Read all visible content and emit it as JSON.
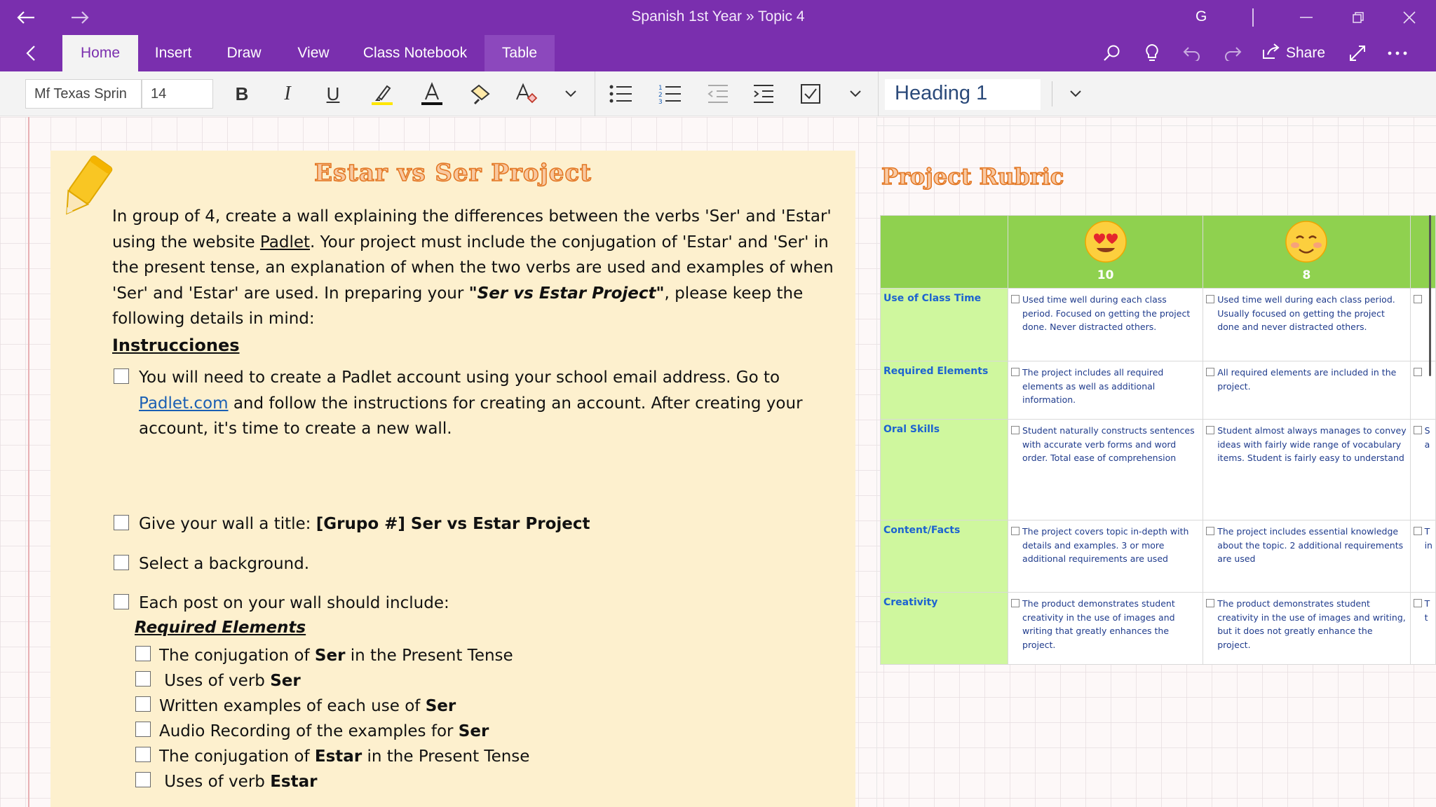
{
  "window": {
    "title": "Spanish 1st Year » Topic 4",
    "user_initial": "G"
  },
  "tabs": {
    "items": [
      {
        "label": "Home",
        "active": true
      },
      {
        "label": "Insert"
      },
      {
        "label": "Draw"
      },
      {
        "label": "View"
      },
      {
        "label": "Class Notebook"
      },
      {
        "label": "Table"
      }
    ],
    "share_label": "Share"
  },
  "toolbar": {
    "font_name": "Mf Texas Sprin",
    "font_size": "14",
    "style": "Heading 1",
    "highlight_color": "#ffe600",
    "font_color": "#111111"
  },
  "project": {
    "title": "Estar vs Ser Project",
    "intro": {
      "p1": "In group of 4, create a wall explaining the differences between the verbs 'Ser' and 'Estar' using the website ",
      "link1": "Padlet",
      "p2": ". Your project must include the conjugation of 'Estar' and 'Ser' in the present tense, an explanation of when the two verbs are used and examples of when 'Ser' and 'Estar' are used. In preparing your ",
      "bold_italic": "\"Ser vs Estar Project\"",
      "p3": ", please keep the following details in mind:"
    },
    "instructions_heading": "Instrucciones",
    "step1": {
      "text_a": "You will need to create a Padlet account using your school email address. Go to ",
      "link": "Padlet.com",
      "text_b": " and follow the instructions for creating an account. After creating your account, it's time to create a new wall."
    },
    "step2": {
      "text": "Give your wall a title: ",
      "bold": "[Grupo #] Ser vs Estar Project"
    },
    "step3": "Select a background.",
    "step4": "Each post on your wall should include:",
    "required_heading": "Required Elements",
    "required": [
      {
        "pre": "The conjugation of ",
        "bold": "Ser",
        "post": " in the Present Tense"
      },
      {
        "pre": " Uses of verb ",
        "bold": "Ser",
        "post": ""
      },
      {
        "pre": "Written examples of each use of ",
        "bold": "Ser",
        "post": ""
      },
      {
        "pre": "Audio Recording of the examples for ",
        "bold": "Ser",
        "post": ""
      },
      {
        "pre": "The conjugation of ",
        "bold": "Estar",
        "post": " in the Present Tense"
      },
      {
        "pre": " Uses of verb ",
        "bold": "Estar",
        "post": ""
      }
    ]
  },
  "rubric": {
    "title": "Project Rubric",
    "scores": [
      "10",
      "8"
    ],
    "emoji_names": [
      "heart-eyes-emoji-icon",
      "smiling-blush-emoji-icon"
    ],
    "rows": [
      {
        "criterion": "Use of Class Time",
        "col1": "Used time well during each class period. Focused on getting the project done. Never distracted others.",
        "col2": "Used time well during each class period. Usually focused on getting the project done and never distracted others."
      },
      {
        "criterion": "Required Elements",
        "col1": "The project includes all required elements as well as additional information.",
        "col2": "All required elements are included in the project."
      },
      {
        "criterion": "Oral Skills",
        "col1": "Student naturally constructs sentences with accurate verb forms and word order. Total ease of comprehension",
        "col2": "Student almost always manages to convey ideas with fairly wide range of vocabulary items. Student is fairly easy to understand"
      },
      {
        "criterion": "Content/Facts",
        "col1": "The project covers topic in-depth with details and examples. 3 or more additional requirements are used",
        "col2": "The project includes essential knowledge about the topic. 2 additional requirements are used"
      },
      {
        "criterion": "Creativity",
        "col1": "The product demonstrates student creativity in the use of images and writing that greatly enhances the project.",
        "col2": "The product demonstrates student creativity in the use of images and writing, but it does not greatly enhance the project."
      }
    ],
    "partial_col": [
      "",
      "",
      "S a",
      "T in",
      "T t"
    ]
  }
}
